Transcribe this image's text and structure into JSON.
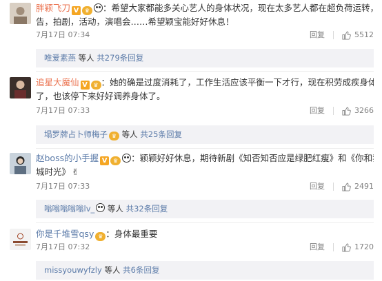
{
  "colors": {
    "username": "#eb7350",
    "link": "#5a7aa8",
    "meta": "#808080"
  },
  "actions": {
    "reply_label": "回复"
  },
  "comments": [
    {
      "username": "胖颖飞刀",
      "text1": "希望大家都能多关心艺人的身体状况，现在太多艺人都在超负荷运转，跑通",
      "text2": "告，拍剧，活动，演唱会……希望颖宝能好好休息！",
      "time": "7月17日 07:34",
      "likes": "5512",
      "sub": {
        "name": "唯爱素燕",
        "summary": "等人 ",
        "more": "共279条回复"
      }
    },
    {
      "username": "追星大魔仙",
      "text1": "她的确是过度消耗了，工作生活应该平衡一下才行，现在积劳成疾身体吃不消",
      "text2": "了，也该停下来好好调养身体了。",
      "time": "7月17日 07:33",
      "likes": "3266",
      "sub": {
        "name": "塌罗牌占卜师梅子",
        "summary": "等人 ",
        "more": "共25条回复"
      }
    },
    {
      "username": "赵boss的小手握",
      "text1": "颖颖好好休息，期待新剧《知否知否应是绿肥红瘦》和《你和我的倾",
      "text2": "城时光》",
      "time": "7月17日 07:33",
      "likes": "2491",
      "sub": {
        "name": "嗡嗡嗡嗡嗡lv_",
        "summary": "等人 ",
        "more": "共32条回复"
      }
    },
    {
      "username": "你是千堆雪qsy",
      "text1": "身体最重要",
      "text2": "",
      "time": "7月17日 07:32",
      "likes": "1720",
      "sub": {
        "name": "missyouwyfzly",
        "summary": "等人 ",
        "more": "共6条回复"
      }
    }
  ]
}
